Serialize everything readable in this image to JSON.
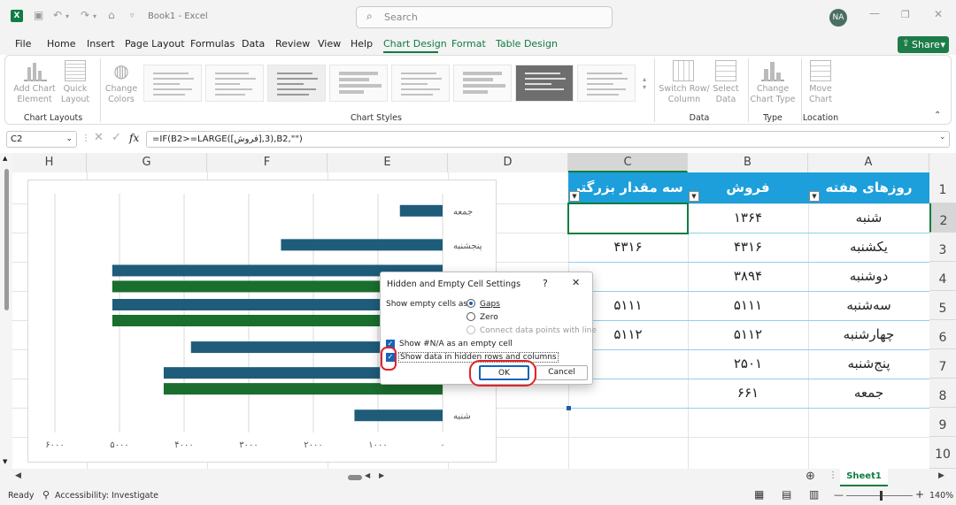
{
  "window": {
    "title": "Book1 - Excel",
    "search_placeholder": "Search",
    "user_initials": "NA"
  },
  "menu": {
    "tabs": [
      "File",
      "Home",
      "Insert",
      "Page Layout",
      "Formulas",
      "Data",
      "Review",
      "View",
      "Help",
      "Chart Design",
      "Format",
      "Table Design"
    ],
    "active": "Chart Design",
    "share_label": "Share"
  },
  "ribbon": {
    "add_chart_element": "Add Chart\nElement",
    "quick_layout": "Quick\nLayout",
    "change_colors": "Change\nColors",
    "switch_row_column": "Switch Row/\nColumn",
    "select_data": "Select\nData",
    "change_chart_type": "Change\nChart Type",
    "move_chart": "Move\nChart",
    "groups": {
      "chart_layouts": "Chart Layouts",
      "chart_styles": "Chart Styles",
      "data": "Data",
      "type": "Type",
      "location": "Location"
    }
  },
  "formula_bar": {
    "name_box": "C2",
    "fx": "fx",
    "formula": "=IF(B2>=LARGE([فروش],3),B2,\"\")"
  },
  "grid": {
    "columns": [
      "H",
      "G",
      "F",
      "E",
      "D",
      "C",
      "B",
      "A"
    ],
    "rows": [
      "1",
      "2",
      "3",
      "4",
      "5",
      "6",
      "7",
      "8",
      "9",
      "10"
    ],
    "table_headers": {
      "A": "روزهای هفته",
      "B": "فروش",
      "C": "سه مقدار بزرگتر"
    },
    "data_rows": [
      {
        "A": "شنبه",
        "B": "۱۳۶۴",
        "C": ""
      },
      {
        "A": "یکشنبه",
        "B": "۴۳۱۶",
        "C": "۴۳۱۶"
      },
      {
        "A": "دوشنبه",
        "B": "۳۸۹۴",
        "C": ""
      },
      {
        "A": "سه‌شنبه",
        "B": "۵۱۱۱",
        "C": "۵۱۱۱"
      },
      {
        "A": "چهارشنبه",
        "B": "۵۱۱۲",
        "C": "۵۱۱۲"
      },
      {
        "A": "پنج‌شنبه",
        "B": "۲۵۰۱",
        "C": ""
      },
      {
        "A": "جمعه",
        "B": "۶۶۱",
        "C": ""
      }
    ]
  },
  "chart_data": {
    "type": "bar",
    "orientation": "horizontal-reversed",
    "categories": [
      "شنبه",
      "یکشنبه",
      "دوشنبه",
      "سه‌شنبه",
      "چهارشنبه",
      "پنج‌شنبه",
      "جمعه"
    ],
    "series": [
      {
        "values": [
          1364,
          4316,
          3894,
          5111,
          5112,
          2501,
          661
        ],
        "color": "#1f5c7a"
      },
      {
        "values": [
          null,
          4316,
          null,
          5111,
          5112,
          null,
          null
        ],
        "color": "#1a6e2e"
      }
    ],
    "xlim": [
      0,
      6000
    ],
    "x_ticks": [
      0,
      1000,
      2000,
      3000,
      4000,
      5000,
      6000
    ],
    "x_tick_labels": [
      "۰",
      "۱۰۰۰",
      "۲۰۰۰",
      "۳۰۰۰",
      "۴۰۰۰",
      "۵۰۰۰",
      "۶۰۰۰"
    ],
    "visible_category_labels": [
      "جمعه",
      "پنجشنبه",
      "شنبه"
    ],
    "grid": true
  },
  "dialog": {
    "title": "Hidden and Empty Cell Settings",
    "help": "?",
    "close": "✕",
    "show_empty_as": "Show empty cells as:",
    "opt_gaps": "Gaps",
    "opt_zero": "Zero",
    "opt_connect": "Connect data points with line",
    "chk_na": "Show #N/A as an empty cell",
    "chk_hidden": "Show data in hidden rows and columns",
    "ok": "OK",
    "cancel": "Cancel"
  },
  "sheet": {
    "tab": "Sheet1"
  },
  "status": {
    "ready": "Ready",
    "accessibility": "Accessibility: Investigate",
    "zoom": "140%"
  }
}
